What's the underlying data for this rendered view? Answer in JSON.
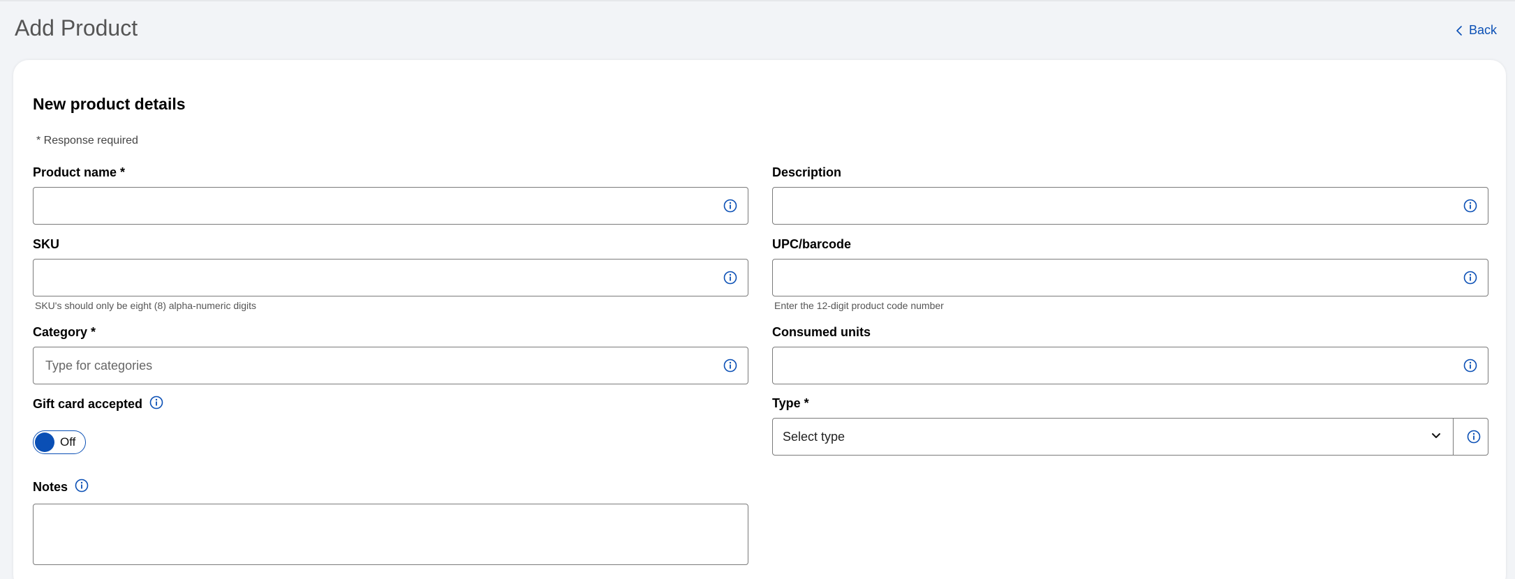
{
  "header": {
    "title": "Add Product",
    "back_label": "Back"
  },
  "form": {
    "section_title": "New product details",
    "required_note": "* Response required",
    "product_name": {
      "label": "Product name *",
      "value": "",
      "placeholder": ""
    },
    "description": {
      "label": "Description",
      "value": "",
      "placeholder": ""
    },
    "sku": {
      "label": "SKU",
      "value": "",
      "placeholder": "",
      "helper": "SKU's should only be eight (8) alpha-numeric digits"
    },
    "upc": {
      "label": "UPC/barcode",
      "value": "",
      "placeholder": "",
      "helper": "Enter the 12-digit product code number"
    },
    "category": {
      "label": "Category *",
      "value": "",
      "placeholder": "Type for categories"
    },
    "consumed_units": {
      "label": "Consumed units",
      "value": "",
      "placeholder": ""
    },
    "gift_card": {
      "label": "Gift card accepted",
      "toggle_text": "Off",
      "on": false
    },
    "type": {
      "label": "Type *",
      "selected": "Select type"
    },
    "notes": {
      "label": "Notes",
      "value": ""
    }
  },
  "colors": {
    "accent": "#0a4fb5",
    "background": "#f2f4f7",
    "card": "#ffffff",
    "border": "#7a7a7a"
  },
  "icons": {
    "info": "info-circle-icon",
    "back": "chevron-left-icon",
    "select": "chevron-down-icon"
  }
}
